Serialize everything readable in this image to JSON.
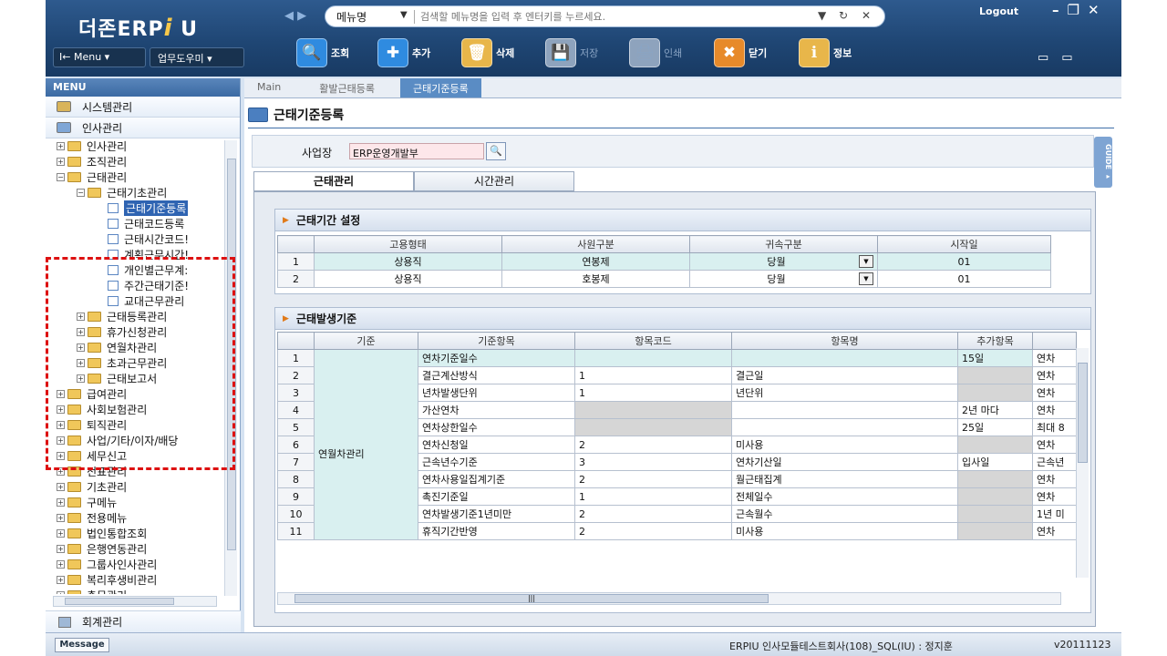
{
  "app": {
    "logo_text": "더존ERP",
    "logo_i": "i",
    "logo_u": "U",
    "logout": "Logout",
    "window_controls": "–❐✕"
  },
  "search": {
    "category": "메뉴명",
    "placeholder": "검색할 메뉴명을 입력 후 엔터키를 누르세요."
  },
  "topleft": {
    "menu_label": "I← Menu ▾",
    "help_label": "업무도우미 ▾"
  },
  "toolbar": [
    {
      "label": "조회",
      "icon": "🔍",
      "color": "#2f8be0",
      "enabled": true
    },
    {
      "label": "추가",
      "icon": "✚",
      "color": "#2f8be0",
      "enabled": true
    },
    {
      "label": "삭제",
      "icon": "🗑",
      "color": "#e8b64a",
      "enabled": true
    },
    {
      "label": "저장",
      "icon": "💾",
      "color": "#8ea3bd",
      "enabled": false
    },
    {
      "label": "인쇄",
      "icon": "🖨",
      "color": "#8ea3bd",
      "enabled": false
    },
    {
      "label": "닫기",
      "icon": "✖",
      "color": "#e78a2a",
      "enabled": true
    },
    {
      "label": "정보",
      "icon": "ℹ",
      "color": "#e8b64a",
      "enabled": true
    }
  ],
  "sidebar": {
    "header": "MENU",
    "groups": [
      "시스템관리",
      "인사관리"
    ],
    "tree": [
      {
        "label": "인사관리",
        "level": 0,
        "type": "folder",
        "pm": "+"
      },
      {
        "label": "조직관리",
        "level": 0,
        "type": "folder",
        "pm": "+"
      },
      {
        "label": "근태관리",
        "level": 0,
        "type": "folder",
        "pm": "−"
      },
      {
        "label": "근태기초관리",
        "level": 1,
        "type": "folder",
        "pm": "−"
      },
      {
        "label": "근태기준등록",
        "level": 2,
        "type": "page",
        "pm": "",
        "selected": true
      },
      {
        "label": "근태코드등록",
        "level": 2,
        "type": "page",
        "pm": ""
      },
      {
        "label": "근태시간코드!",
        "level": 2,
        "type": "page",
        "pm": ""
      },
      {
        "label": "계획근무시간!",
        "level": 2,
        "type": "page",
        "pm": ""
      },
      {
        "label": "개인별근무계:",
        "level": 2,
        "type": "page",
        "pm": ""
      },
      {
        "label": "주간근태기준!",
        "level": 2,
        "type": "page",
        "pm": ""
      },
      {
        "label": "교대근무관리",
        "level": 2,
        "type": "page",
        "pm": ""
      },
      {
        "label": "근태등록관리",
        "level": 1,
        "type": "folder",
        "pm": "+"
      },
      {
        "label": "휴가신청관리",
        "level": 1,
        "type": "folder",
        "pm": "+"
      },
      {
        "label": "연월차관리",
        "level": 1,
        "type": "folder",
        "pm": "+"
      },
      {
        "label": "초과근무관리",
        "level": 1,
        "type": "folder",
        "pm": "+"
      },
      {
        "label": "근태보고서",
        "level": 1,
        "type": "folder",
        "pm": "+"
      },
      {
        "label": "급여관리",
        "level": 0,
        "type": "folder",
        "pm": "+"
      },
      {
        "label": "사회보험관리",
        "level": 0,
        "type": "folder",
        "pm": "+"
      },
      {
        "label": "퇴직관리",
        "level": 0,
        "type": "folder",
        "pm": "+"
      },
      {
        "label": "사업/기타/이자/배당",
        "level": 0,
        "type": "folder",
        "pm": "+"
      },
      {
        "label": "세무신고",
        "level": 0,
        "type": "folder",
        "pm": "+"
      },
      {
        "label": "전표관리",
        "level": 0,
        "type": "folder",
        "pm": "+"
      },
      {
        "label": "기초관리",
        "level": 0,
        "type": "folder",
        "pm": "+"
      },
      {
        "label": "구메뉴",
        "level": 0,
        "type": "folder",
        "pm": "+"
      },
      {
        "label": "전용메뉴",
        "level": 0,
        "type": "folder",
        "pm": "+"
      },
      {
        "label": "법인통합조회",
        "level": 0,
        "type": "folder",
        "pm": "+"
      },
      {
        "label": "은행연동관리",
        "level": 0,
        "type": "folder",
        "pm": "+"
      },
      {
        "label": "그룹사인사관리",
        "level": 0,
        "type": "folder",
        "pm": "+"
      },
      {
        "label": "복리후생비관리",
        "level": 0,
        "type": "folder",
        "pm": "+"
      },
      {
        "label": "총무관리",
        "level": 0,
        "type": "folder",
        "pm": "+"
      }
    ],
    "footer": "회계관리"
  },
  "tabs": [
    {
      "label": "Main",
      "active": false
    },
    {
      "label": "활발근태등록",
      "active": false
    },
    {
      "label": "근태기준등록",
      "active": true
    }
  ],
  "page": {
    "title": "근태기준등록",
    "site_label": "사업장",
    "site_value": "ERP운영개발부",
    "guide": "GUIDE ▸",
    "subtabs": [
      "근태관리",
      "시간관리"
    ]
  },
  "period_section": {
    "title": "근태기간 설정",
    "headers": [
      "고용형태",
      "사원구분",
      "귀속구분",
      "시작일"
    ],
    "rows": [
      {
        "no": "1",
        "cells": [
          "상용직",
          "연봉제",
          "당월",
          "01"
        ]
      },
      {
        "no": "2",
        "cells": [
          "상용직",
          "호봉제",
          "당월",
          "01"
        ]
      }
    ]
  },
  "occurrence_section": {
    "title": "근태발생기준",
    "headers": [
      "기준",
      "기준항목",
      "항목코드",
      "항목명",
      "추가항목",
      ""
    ],
    "group_label": "연월차관리",
    "rows": [
      {
        "no": "1",
        "item": "연차기준일수",
        "code": "",
        "name": "",
        "extra": "15일",
        "more": "연차"
      },
      {
        "no": "2",
        "item": "결근계산방식",
        "code": "1",
        "name": "결근일",
        "extra": "",
        "more": "연차"
      },
      {
        "no": "3",
        "item": "년차발생단위",
        "code": "1",
        "name": "년단위",
        "extra": "",
        "more": "연차"
      },
      {
        "no": "4",
        "item": "가산연차",
        "code": "",
        "name": "",
        "extra": "2년 마다",
        "more": "연차"
      },
      {
        "no": "5",
        "item": "연차상한일수",
        "code": "",
        "name": "",
        "extra": "25일",
        "more": "최대 8"
      },
      {
        "no": "6",
        "item": "연차신청일",
        "code": "2",
        "name": "미사용",
        "extra": "",
        "more": "연차"
      },
      {
        "no": "7",
        "item": "근속년수기준",
        "code": "3",
        "name": "연차기산일",
        "extra": "입사일",
        "more": "근속년"
      },
      {
        "no": "8",
        "item": "연차사용일집계기준",
        "code": "2",
        "name": "월근태집계",
        "extra": "",
        "more": "연차"
      },
      {
        "no": "9",
        "item": "촉진기준일",
        "code": "1",
        "name": "전체일수",
        "extra": "",
        "more": "연차"
      },
      {
        "no": "10",
        "item": "연차발생기준1년미만",
        "code": "2",
        "name": "근속월수",
        "extra": "",
        "more": "1년 미"
      },
      {
        "no": "11",
        "item": "휴직기간반영",
        "code": "2",
        "name": "미사용",
        "extra": "",
        "more": "연차"
      }
    ]
  },
  "status": {
    "message_btn": "Message",
    "info": "ERPIU 인사모듈테스트회사(108)_SQL(IU) : 정지훈",
    "version": "v20111123"
  }
}
